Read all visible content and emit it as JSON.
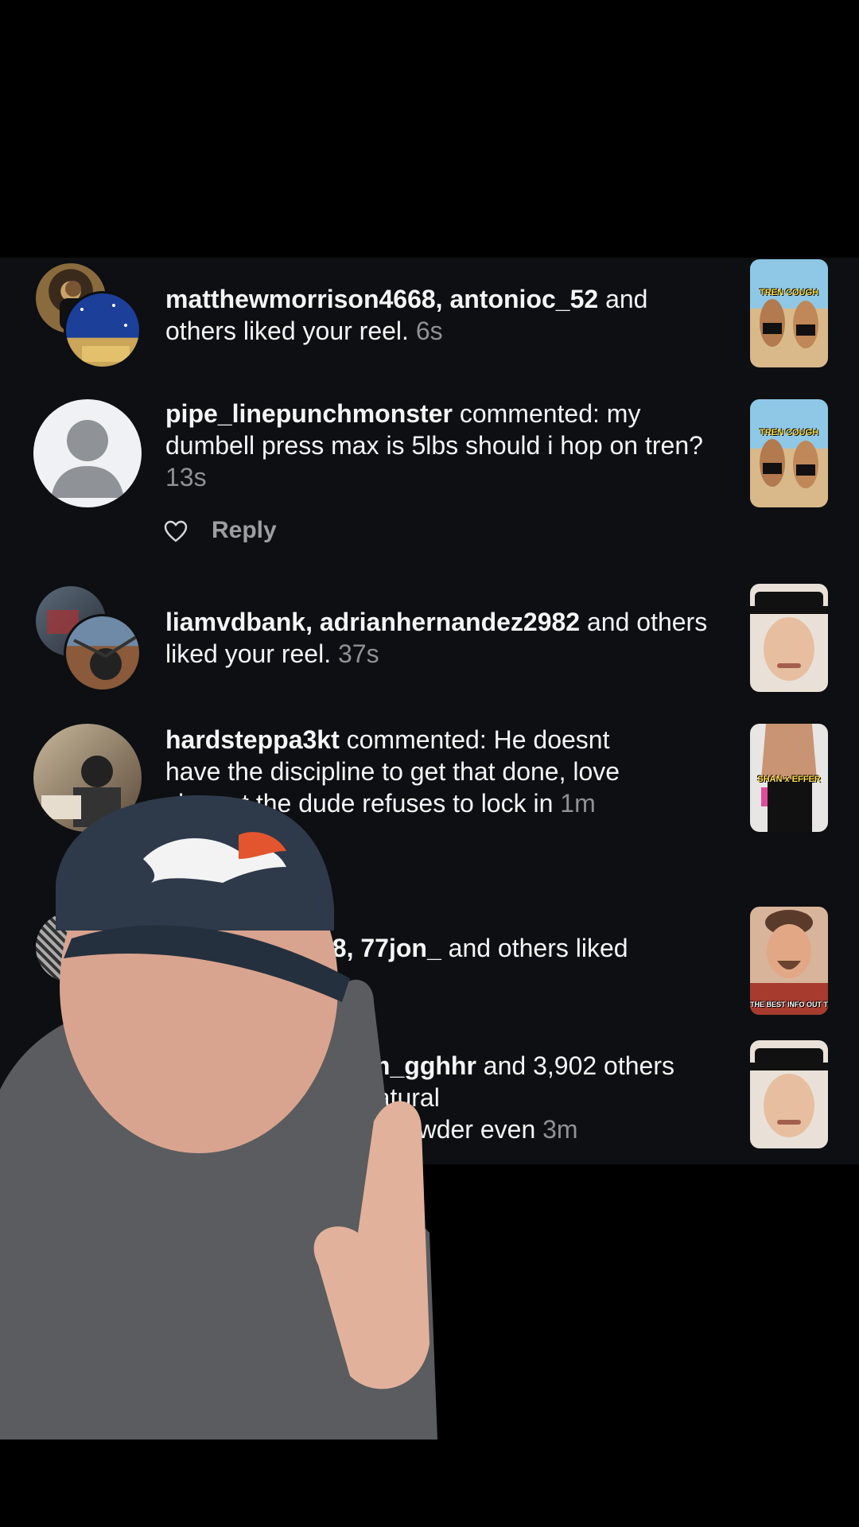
{
  "notifications": [
    {
      "type": "like",
      "users": "matthewmorrison4668, antonioc_52",
      "message": " and others liked your reel.",
      "time": "6s",
      "thumb_label": "TREN COUGH",
      "avatar_icons": [
        "user-avatar-photo",
        "user-avatar-photo"
      ]
    },
    {
      "type": "comment",
      "users": "pipe_linepunchmonster",
      "message": " commented: my dumbell press max is 5lbs should i hop on tren?",
      "time": "13s",
      "thumb_label": "TREN COUGH",
      "reply_label": "Reply",
      "avatar_icons": [
        "default-user-icon"
      ]
    },
    {
      "type": "like",
      "users": "liamvdbank, adrianhernandez2982",
      "message": " and others liked your reel.",
      "time": "37s",
      "thumb_label": "",
      "avatar_icons": [
        "user-avatar-photo",
        "user-avatar-photo"
      ]
    },
    {
      "type": "comment",
      "users": "hardsteppa3kt",
      "message_line1": " commented: He doesnt",
      "message_line2": "have the discipline to get that done, love",
      "message_line3": "sh     ut the dude refuses to lock in",
      "time": "1m",
      "thumb_label": "SHAN x EFFER",
      "avatar_icons": [
        "user-avatar-photo"
      ]
    },
    {
      "type": "like",
      "users": "28, 77jon_",
      "message": " and others liked",
      "time": "",
      "thumb_label": "THE BEST INFO OUT THAR",
      "avatar_icons": [
        "user-avatar-photo"
      ]
    },
    {
      "type": "like",
      "users": "don, sem_gghhr",
      "message": " and 3,902 others",
      "line2": "ent: All natural",
      "line3": "powder even",
      "time": "3m",
      "thumb_label": "",
      "avatar_icons": [
        "user-avatar-photo"
      ]
    }
  ],
  "colors": {
    "background": "#000000",
    "panel": "#0d0f12",
    "text": "#f5f5f5",
    "muted": "#8e9196",
    "thumb_label": "#ffe14a"
  }
}
